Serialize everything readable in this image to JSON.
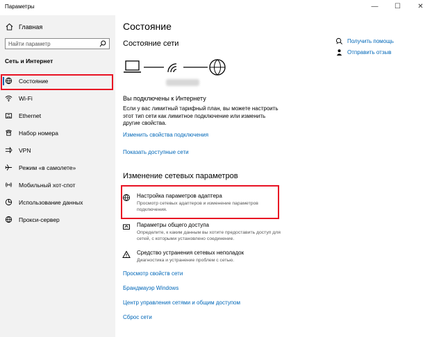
{
  "window": {
    "title": "Параметры",
    "minimize": "—",
    "maximize": "☐",
    "close": "✕"
  },
  "sidebar": {
    "home_label": "Главная",
    "search_placeholder": "Найти параметр",
    "section_title": "Сеть и Интернет",
    "items": [
      {
        "label": "Состояние",
        "icon": "status-icon"
      },
      {
        "label": "Wi-Fi",
        "icon": "wifi-icon"
      },
      {
        "label": "Ethernet",
        "icon": "ethernet-icon"
      },
      {
        "label": "Набор номера",
        "icon": "dialup-icon"
      },
      {
        "label": "VPN",
        "icon": "vpn-icon"
      },
      {
        "label": "Режим «в самолете»",
        "icon": "airplane-icon"
      },
      {
        "label": "Мобильный хот-спот",
        "icon": "hotspot-icon"
      },
      {
        "label": "Использование данных",
        "icon": "data-usage-icon"
      },
      {
        "label": "Прокси-сервер",
        "icon": "globe-icon"
      }
    ]
  },
  "main": {
    "title": "Состояние",
    "network_status_title": "Состояние сети",
    "connected_title": "Вы подключены к Интернету",
    "connected_desc": "Если у вас лимитный тарифный план, вы можете настроить этот тип сети как лимитное подключение или изменить другие свойства.",
    "link_change_props": "Изменить свойства подключения",
    "link_show_networks": "Показать доступные сети",
    "change_section_title": "Изменение сетевых параметров",
    "settings": [
      {
        "title": "Настройка параметров адаптера",
        "desc1": "Просмотр сетевых адаптеров и изменение параметров",
        "desc2": "подключения.",
        "icon": "adapter-globe-icon"
      },
      {
        "title": "Параметры общего доступа",
        "desc1": "Определите, к каким данным вы хотите предоставить доступ для",
        "desc2": "сетей, с которыми установлено соединение.",
        "icon": "sharing-icon"
      },
      {
        "title": "Средство устранения сетевых неполадок",
        "desc1": "Диагностика и устранение проблем с сетью.",
        "desc2": "",
        "icon": "warning-icon"
      }
    ],
    "link_view_props": "Просмотр свойств сети",
    "link_firewall": "Брандмауэр Windows",
    "link_network_center": "Центр управления сетями и общим доступом",
    "link_reset": "Сброс сети"
  },
  "help": {
    "get_help": "Получить помощь",
    "feedback": "Отправить отзыв"
  },
  "colors": {
    "accent": "#0067b8",
    "highlight": "#e81123",
    "sidebar_bg": "#f2f2f2"
  }
}
